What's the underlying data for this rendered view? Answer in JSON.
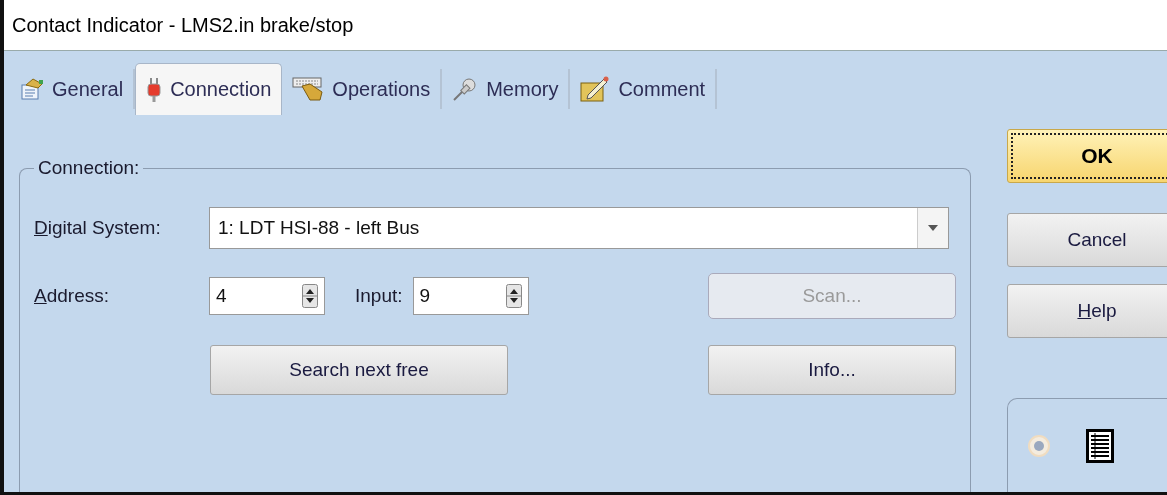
{
  "window": {
    "title": "Contact Indicator - LMS2.in brake/stop"
  },
  "tabs": [
    {
      "label": "General",
      "selected": false,
      "kind": "general"
    },
    {
      "label": "Connection",
      "selected": true,
      "kind": "connection"
    },
    {
      "label": "Operations",
      "selected": false,
      "kind": "operations"
    },
    {
      "label": "Memory",
      "selected": false,
      "kind": "memory"
    },
    {
      "label": "Comment",
      "selected": false,
      "kind": "comment"
    }
  ],
  "connection_group": {
    "title": "Connection:",
    "digital_system": {
      "label": {
        "mnemonic": "D",
        "rest": "igital System:"
      },
      "value": "1: LDT HSI-88 - left Bus"
    },
    "address": {
      "label": {
        "mnemonic": "A",
        "rest": "ddress:"
      },
      "value": "4"
    },
    "input": {
      "label": "Input:",
      "value": "9"
    },
    "scan_button": {
      "label": "Scan...",
      "disabled": true
    },
    "search_button": {
      "label": "Search next free"
    },
    "info_button": {
      "label": "Info..."
    }
  },
  "buttons": [
    {
      "kind": "default",
      "label": {
        "rest": "OK"
      }
    },
    {
      "kind": "normal",
      "label": {
        "rest": "Cancel"
      }
    },
    {
      "kind": "normal",
      "label": {
        "mnemonic": "H",
        "rest": "elp"
      }
    }
  ],
  "view_panel": {
    "radio": {
      "selected": true,
      "disabled": true
    }
  }
}
